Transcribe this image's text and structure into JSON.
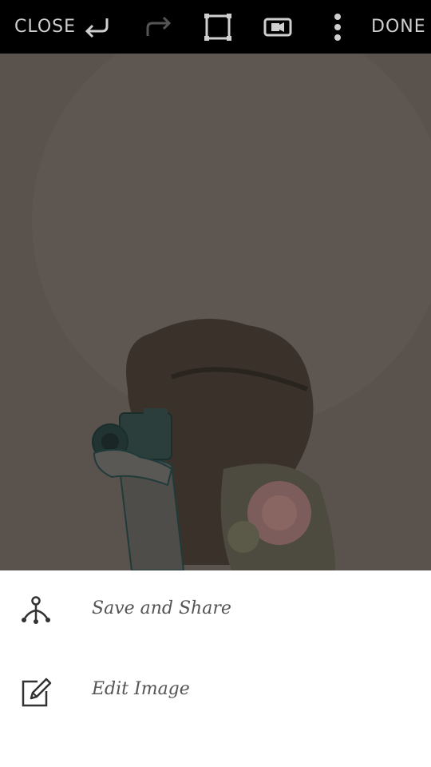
{
  "toolbar": {
    "close_label": "CLOSE",
    "done_label": "DONE",
    "icons": [
      "undo-icon",
      "redo-icon",
      "crop-icon",
      "video-icon",
      "more-vertical-icon"
    ]
  },
  "colors": {
    "toolbar_bg": "#000000",
    "canvas_overlay": "#5a524d",
    "sheet_bg": "#ffffff",
    "text": "#555555"
  },
  "sheet": {
    "items": [
      {
        "icon": "share-icon",
        "label": "Save and Share"
      },
      {
        "icon": "edit-icon",
        "label": "Edit Image"
      }
    ]
  }
}
